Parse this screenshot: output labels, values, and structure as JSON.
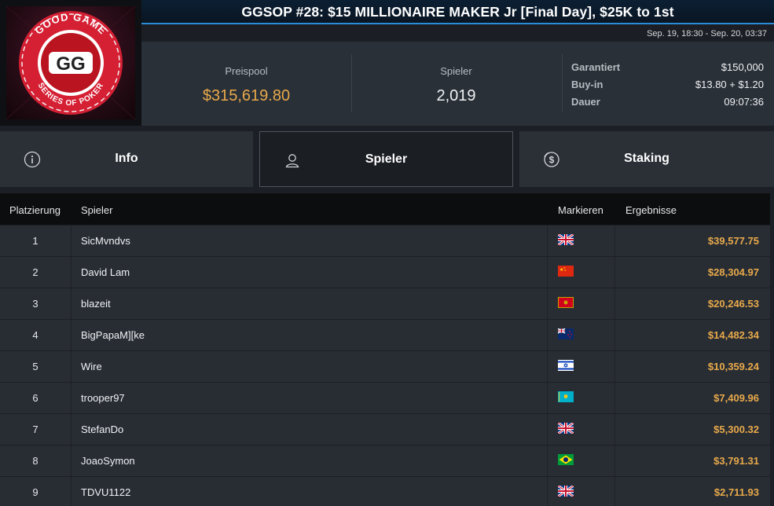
{
  "header": {
    "title": "GGSOP #28: $15 MILLIONAIRE MAKER Jr [Final Day], $25K to 1st",
    "dates": "Sep. 19, 18:30 - Sep. 20, 03:37",
    "logo": {
      "top_text": "GOOD GAME",
      "bottom_text": "SERIES OF POKER",
      "mark": "GG"
    }
  },
  "stats": {
    "prizepool_label": "Preispool",
    "prizepool_value": "$315,619.80",
    "players_label": "Spieler",
    "players_value": "2,019",
    "guaranteed_label": "Garantiert",
    "guaranteed_value": "$150,000",
    "buyin_label": "Buy-in",
    "buyin_value": "$13.80 + $1.20",
    "duration_label": "Dauer",
    "duration_value": "09:07:36"
  },
  "tabs": [
    {
      "label": "Info",
      "icon": "info-icon",
      "active": false
    },
    {
      "label": "Spieler",
      "icon": "user-icon",
      "active": true
    },
    {
      "label": "Staking",
      "icon": "dollar-coin-icon",
      "active": false
    }
  ],
  "table": {
    "columns": [
      "Platzierung",
      "Spieler",
      "Markieren",
      "Ergebnisse"
    ],
    "rows": [
      {
        "rank": "1",
        "name": "SicMvndvs",
        "flag": "uk-flag-icon",
        "result": "$39,577.75"
      },
      {
        "rank": "2",
        "name": "David Lam",
        "flag": "china-flag-icon",
        "result": "$28,304.97"
      },
      {
        "rank": "3",
        "name": "blazeit",
        "flag": "montenegro-flag-icon",
        "result": "$20,246.53"
      },
      {
        "rank": "4",
        "name": "BigPapaM][ke",
        "flag": "new-zealand-flag-icon",
        "result": "$14,482.34"
      },
      {
        "rank": "5",
        "name": "Wire",
        "flag": "israel-flag-icon",
        "result": "$10,359.24"
      },
      {
        "rank": "6",
        "name": "trooper97",
        "flag": "kazakhstan-flag-icon",
        "result": "$7,409.96"
      },
      {
        "rank": "7",
        "name": "StefanDo",
        "flag": "uk-flag-icon",
        "result": "$5,300.32"
      },
      {
        "rank": "8",
        "name": "JoaoSymon",
        "flag": "brazil-flag-icon",
        "result": "$3,791.31"
      },
      {
        "rank": "9",
        "name": "TDVU1122",
        "flag": "uk-flag-icon",
        "result": "$2,711.93"
      }
    ]
  },
  "colors": {
    "accent_gold": "#e8a94a",
    "title_underline": "#2a8bd6",
    "logo_red": "#d51f33"
  }
}
